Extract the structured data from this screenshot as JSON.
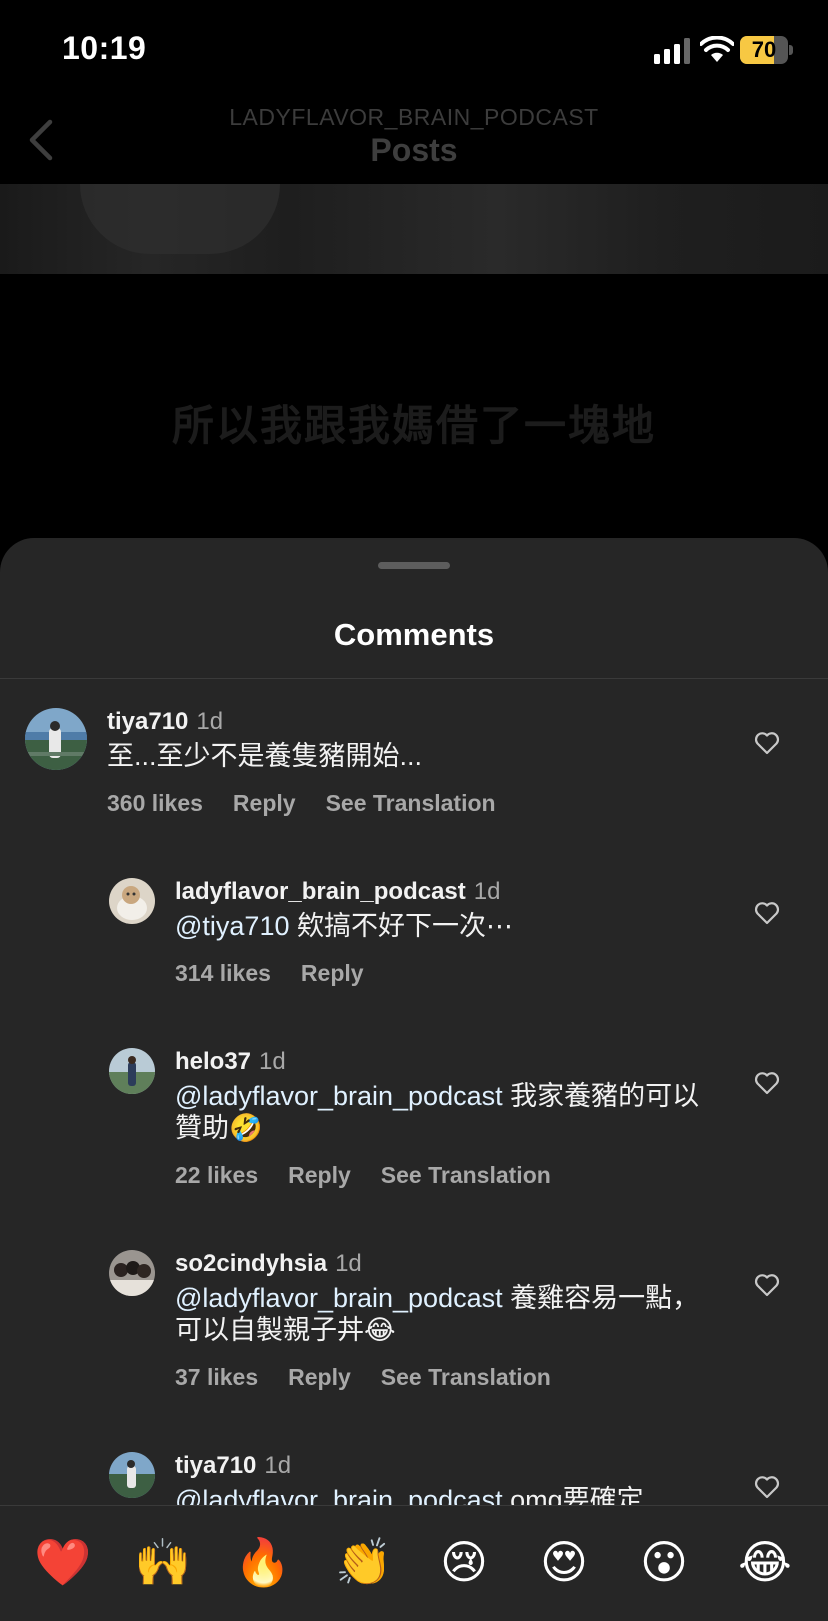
{
  "status_bar": {
    "time": "10:19",
    "battery": "70",
    "battery_level": 0.7
  },
  "header": {
    "username": "LADYFLAVOR_BRAIN_PODCAST",
    "title": "Posts"
  },
  "post": {
    "subtitle": "所以我跟我媽借了一塊地"
  },
  "sheet": {
    "title": "Comments"
  },
  "comments": [
    {
      "user": "tiya710",
      "time": "1d",
      "mention": "",
      "text": "至...至少不是養隻豬開始...",
      "likes": "360 likes",
      "reply": "Reply",
      "translate": "See Translation"
    },
    {
      "user": "ladyflavor_brain_podcast",
      "time": "1d",
      "mention": "@tiya710",
      "text": " 欸搞不好下一次⋯",
      "likes": "314 likes",
      "reply": "Reply",
      "translate": ""
    },
    {
      "user": "helo37",
      "time": "1d",
      "mention": "@ladyflavor_brain_podcast",
      "text": " 我家養豬的可以贊助🤣",
      "likes": "22 likes",
      "reply": "Reply",
      "translate": "See Translation"
    },
    {
      "user": "so2cindyhsia",
      "time": "1d",
      "mention": "@ladyflavor_brain_podcast",
      "text": " 養雞容易一點，可以自製親子丼😂",
      "likes": "37 likes",
      "reply": "Reply",
      "translate": "See Translation"
    },
    {
      "user": "tiya710",
      "time": "1d",
      "mention": "@ladyflavor_brain_podcast",
      "text": " omg要確定",
      "likes": "",
      "reply": "",
      "translate": ""
    }
  ],
  "emoji_bar": [
    "❤️",
    "🙌",
    "🔥",
    "👏",
    "😢",
    "😍",
    "😮",
    "😂"
  ]
}
